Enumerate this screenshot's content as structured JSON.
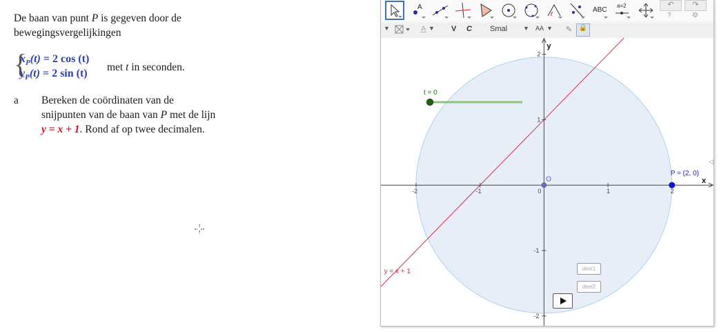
{
  "document": {
    "intro_line1": "De baan van punt P is gegeven door de",
    "intro_line2": "bewegingsvergelijkingen",
    "eq_x": "xP(t) = 2 cos (t)",
    "eq_y": "yP(t) = 2 sin (t)",
    "eq_note": "met t in seconden.",
    "question_label": "a",
    "question_line1": "Bereken de coördinaten van de",
    "question_line2": "snijpunten van de baan van P met de lijn",
    "question_line3_eq": "y = x + 1",
    "question_line3_rest": ". Rond af op twee decimalen."
  },
  "geogebra": {
    "toolbar": {
      "tools": [
        "move-tool",
        "point-tool",
        "line-tool",
        "perpendicular-tool",
        "polygon-tool",
        "circle-tool",
        "conic-tool",
        "angle-tool",
        "reflect-tool",
        "text-tool",
        "slider-tool",
        "move-view-tool"
      ],
      "text_tool_label": "ABC",
      "slider_tool_label": "a=2",
      "undo_icon": "undo-icon",
      "redo_icon": "redo-icon"
    },
    "stylebar": {
      "bold": "V",
      "italic": "C",
      "size": "Smal",
      "font_letter": "A",
      "size_letters": "AA"
    },
    "axes": {
      "x_label": "x",
      "y_label": "y",
      "x_ticks": [
        "-2",
        "-1",
        "0",
        "1",
        "2"
      ],
      "y_ticks": [
        "2",
        "1",
        "-1",
        "-2"
      ],
      "origin_label": "O",
      "xlim": [
        -2.55,
        2.65
      ],
      "ylim": [
        -2.15,
        2.25
      ]
    },
    "slider": {
      "label": "t = 0",
      "value": 0
    },
    "circle": {
      "radius": 2,
      "fill": "#e8eef7",
      "stroke": "#a9d3ef"
    },
    "line": {
      "label": "y = x + 1",
      "color": "#d2334a",
      "slope": 1,
      "intercept": 1
    },
    "point": {
      "label": "P = (2, 0)",
      "x": 2,
      "y": 0,
      "color": "#1414d6"
    },
    "buttons": {
      "deel1": "deel1",
      "deel2": "deel2",
      "play": "play-icon"
    }
  }
}
